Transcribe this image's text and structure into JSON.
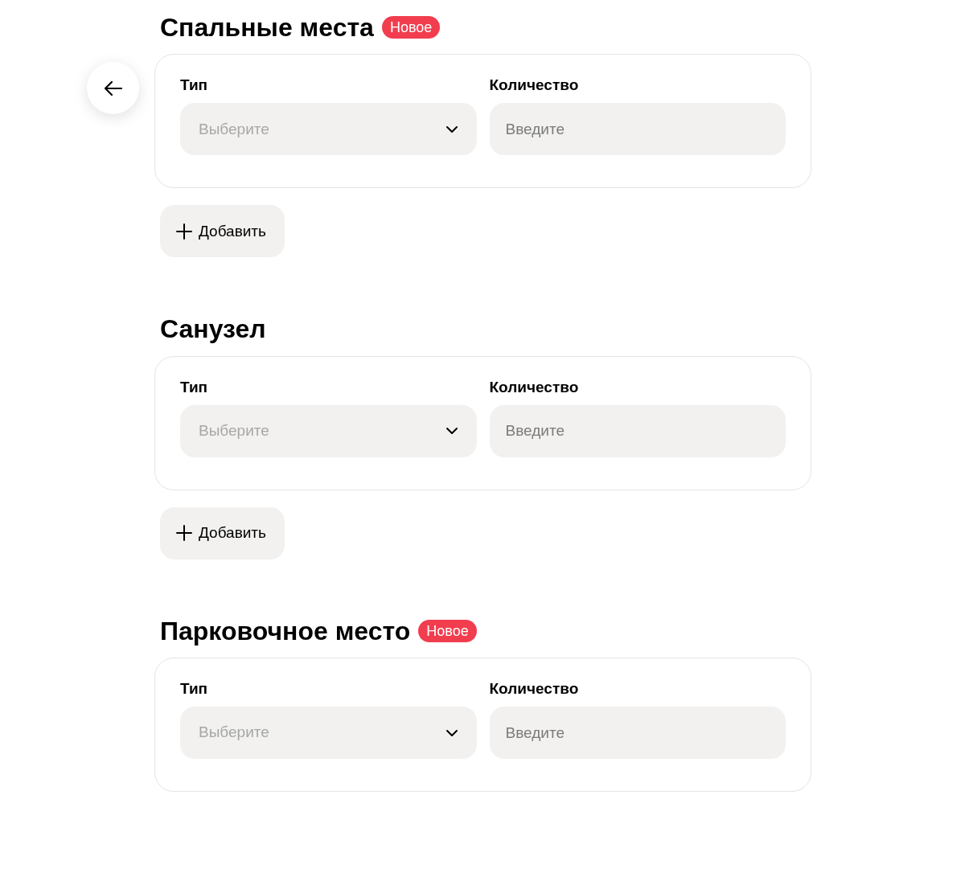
{
  "back_button": {
    "kind": "back"
  },
  "sections": [
    {
      "title": "Спальные места",
      "badge": "Новое",
      "fields": [
        {
          "label": "Тип",
          "kind": "select",
          "placeholder": "Выберите"
        },
        {
          "label": "Количество",
          "kind": "input",
          "placeholder": "Введите"
        }
      ],
      "add_button": "Добавить"
    },
    {
      "title": "Санузел",
      "fields": [
        {
          "label": "Тип",
          "kind": "select",
          "placeholder": "Выберите"
        },
        {
          "label": "Количество",
          "kind": "input",
          "placeholder": "Введите"
        }
      ],
      "add_button": "Добавить"
    },
    {
      "title": "Парковочное место",
      "badge": "Новое",
      "fields": [
        {
          "label": "Тип",
          "kind": "select",
          "placeholder": "Выберите"
        },
        {
          "label": "Количество",
          "kind": "input",
          "placeholder": "Введите"
        }
      ]
    }
  ]
}
